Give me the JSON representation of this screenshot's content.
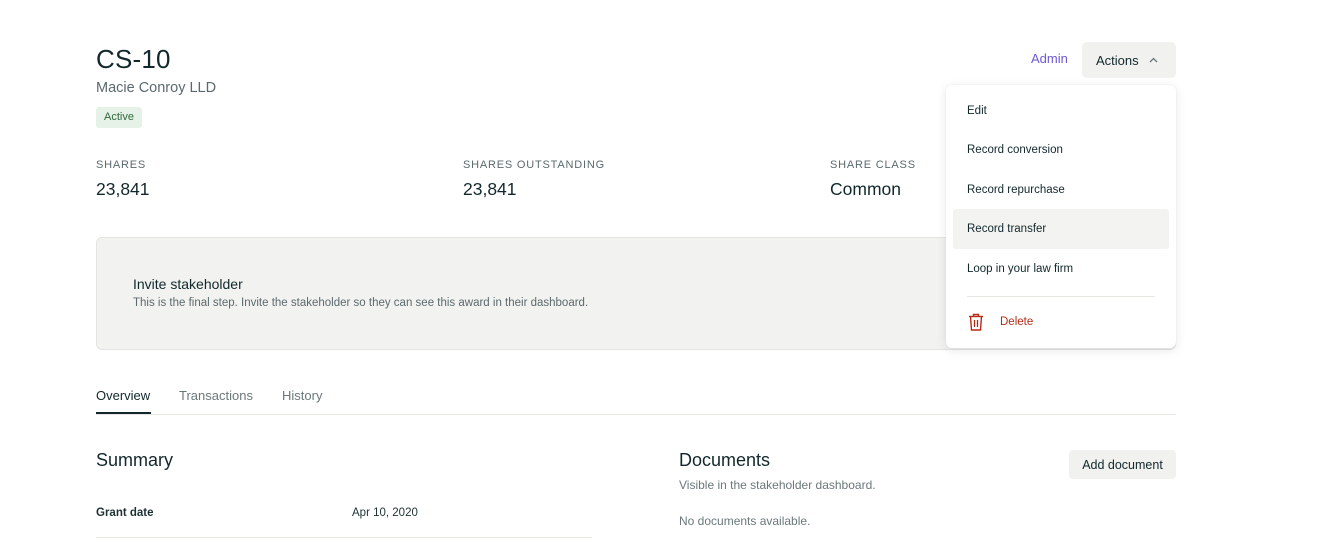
{
  "header": {
    "title": "CS-10",
    "subtitle": "Macie Conroy LLD",
    "status_badge": "Active",
    "admin_link": "Admin",
    "actions_label": "Actions"
  },
  "stats": [
    {
      "label": "SHARES",
      "value": "23,841"
    },
    {
      "label": "SHARES OUTSTANDING",
      "value": "23,841"
    },
    {
      "label": "SHARE CLASS",
      "value": "Common"
    }
  ],
  "invite": {
    "title": "Invite stakeholder",
    "description": "This is the final step. Invite the stakeholder so they can see this award in their dashboard."
  },
  "tabs": [
    {
      "label": "Overview",
      "active": true
    },
    {
      "label": "Transactions",
      "active": false
    },
    {
      "label": "History",
      "active": false
    }
  ],
  "summary": {
    "title": "Summary",
    "rows": [
      {
        "label": "Grant date",
        "value": "Apr 10, 2020"
      }
    ]
  },
  "documents": {
    "title": "Documents",
    "subtitle": "Visible in the stakeholder dashboard.",
    "empty_text": "No documents available.",
    "add_label": "Add document"
  },
  "actions_menu": {
    "items": [
      {
        "label": "Edit"
      },
      {
        "label": "Record conversion"
      },
      {
        "label": "Record repurchase"
      },
      {
        "label": "Record transfer",
        "hovered": true
      },
      {
        "label": "Loop in your law firm"
      }
    ],
    "delete_label": "Delete",
    "delete_icon": "trash-icon",
    "actions_icon": "chevron-up-icon"
  },
  "colors": {
    "accent": "#6a59d6",
    "danger": "#b42c18",
    "badge_bg": "#e6f1e7",
    "badge_text": "#2e6b3a"
  }
}
